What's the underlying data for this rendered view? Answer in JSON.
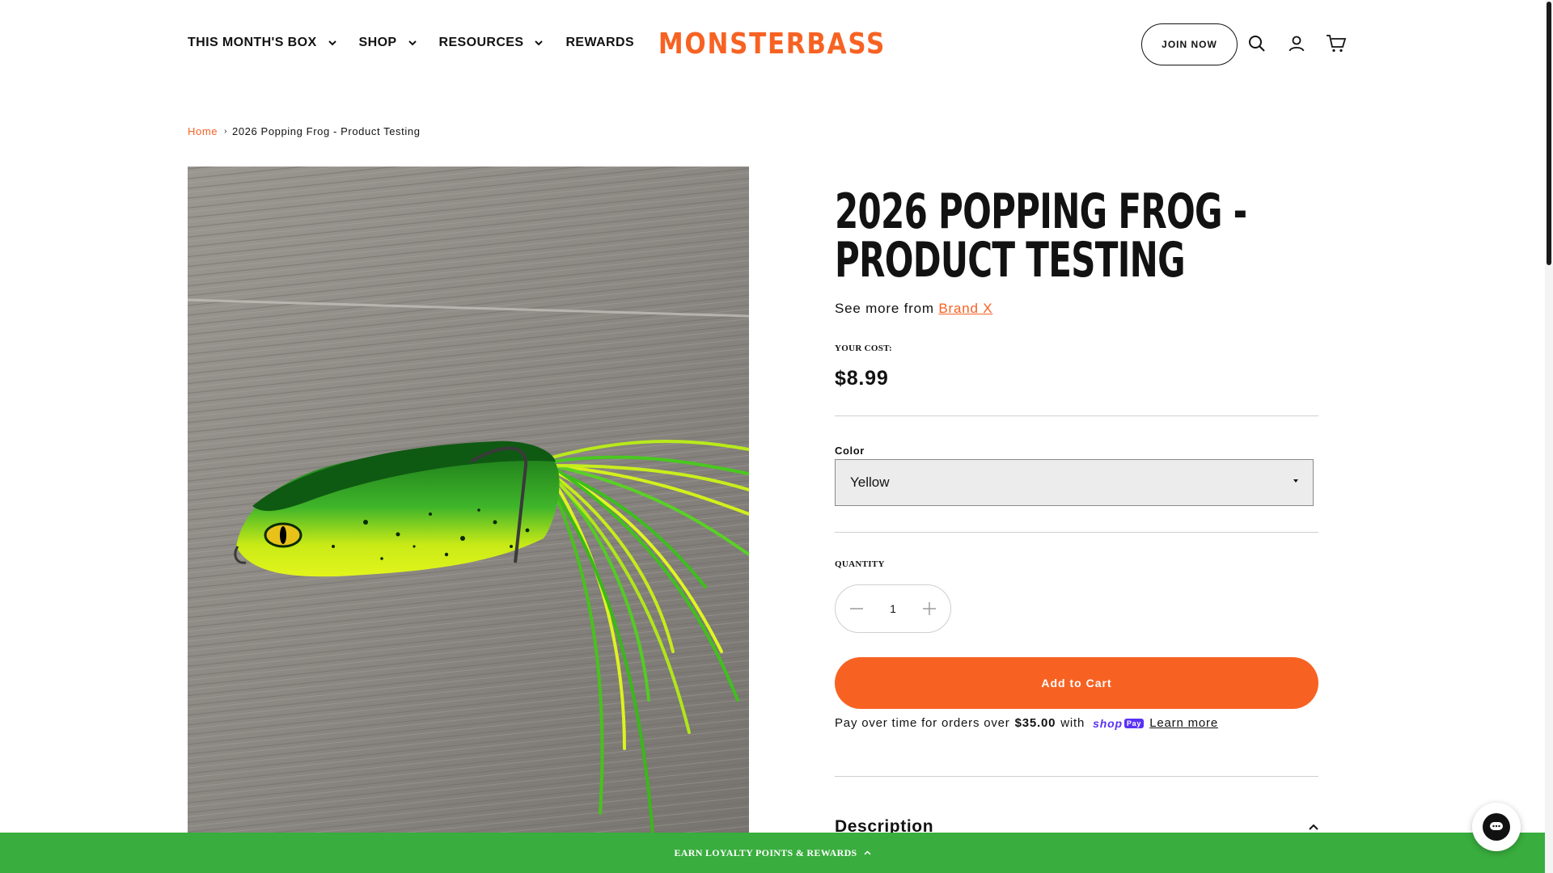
{
  "header": {
    "nav": [
      {
        "label": "THIS MONTH'S BOX",
        "has_dropdown": true
      },
      {
        "label": "SHOP",
        "has_dropdown": true
      },
      {
        "label": "RESOURCES",
        "has_dropdown": true
      },
      {
        "label": "REWARDS",
        "has_dropdown": false
      }
    ],
    "logo": "MONSTERBASS",
    "join_label": "JOIN NOW",
    "icons": [
      "search-icon",
      "account-icon",
      "cart-icon"
    ]
  },
  "breadcrumb": {
    "home": "Home",
    "current": "2026 Popping Frog - Product Testing"
  },
  "product": {
    "title": "2026 Popping Frog - Product Testing",
    "see_more_prefix": "See more from",
    "brand": "Brand X",
    "cost_label": "YOUR COST:",
    "price": "$8.99",
    "color_label": "Color",
    "color_selected": "Yellow",
    "quantity_label": "QUANTITY",
    "quantity": "1",
    "add_to_cart": "Add to Cart",
    "shoppay": {
      "prefix": "Pay over time for orders over",
      "amount": "$35.00",
      "with": "with",
      "brand_shop": "shop",
      "brand_pay": "Pay",
      "learn_more": "Learn more"
    },
    "description_label": "Description"
  },
  "footer_bar": {
    "label": "EARN LOYALTY POINTS & REWARDS"
  },
  "colors": {
    "accent": "#f76223",
    "loyalty_bar": "#39ad3e",
    "text": "#121212",
    "frog_green": "#22a31c",
    "frog_yellow": "#d4ee14"
  }
}
